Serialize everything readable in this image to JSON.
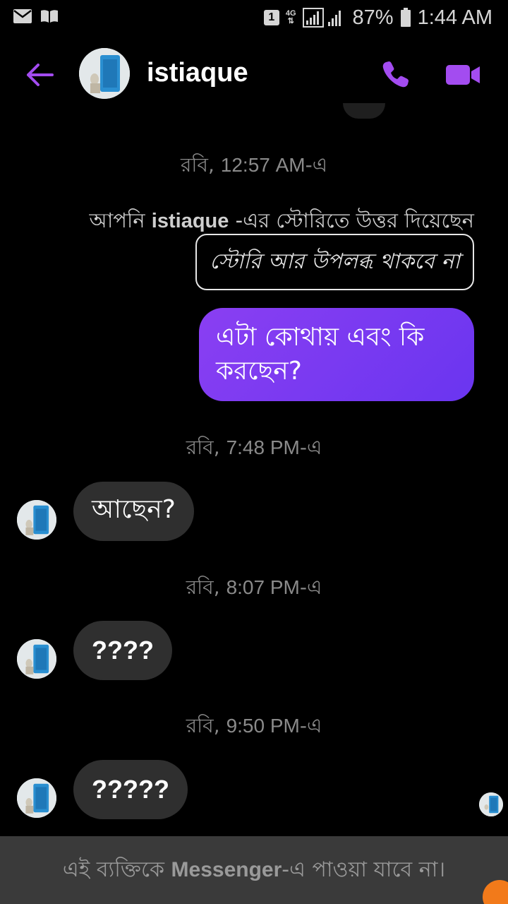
{
  "status_bar": {
    "sim": "1",
    "network": "4G",
    "battery": "87%",
    "time": "1:44 AM",
    "icons": [
      "mail-icon",
      "book-icon",
      "signal-icon",
      "battery-icon"
    ]
  },
  "header": {
    "contact_name": "istiaque",
    "accent": "#a34cf0"
  },
  "timestamps": {
    "t1": {
      "day": "রবি,",
      "time": "12:57 AM",
      "suffix": "-এ"
    },
    "t2": {
      "day": "রবি,",
      "time": "7:48 PM",
      "suffix": "-এ"
    },
    "t3": {
      "day": "রবি,",
      "time": "8:07 PM",
      "suffix": "-এ"
    },
    "t4": {
      "day": "রবি,",
      "time": "9:50 PM",
      "suffix": "-এ"
    }
  },
  "story_reply": {
    "prefix": "আপনি ",
    "name": "istiaque",
    "suffix": " -এর স্টোরিতে উত্তর দিয়েছেন",
    "unavailable": "স্টোরি আর উপলব্ধ থাকবে না"
  },
  "messages": {
    "outgoing_1": "এটা কোথায় এবং কি করছেন?",
    "incoming_1": "আছেন?",
    "incoming_2": "????",
    "incoming_3": "?????"
  },
  "footer": {
    "prefix": "এই ব্যক্তিকে ",
    "app": "Messenger",
    "suffix": "-এ পাওয়া যাবে না।"
  }
}
